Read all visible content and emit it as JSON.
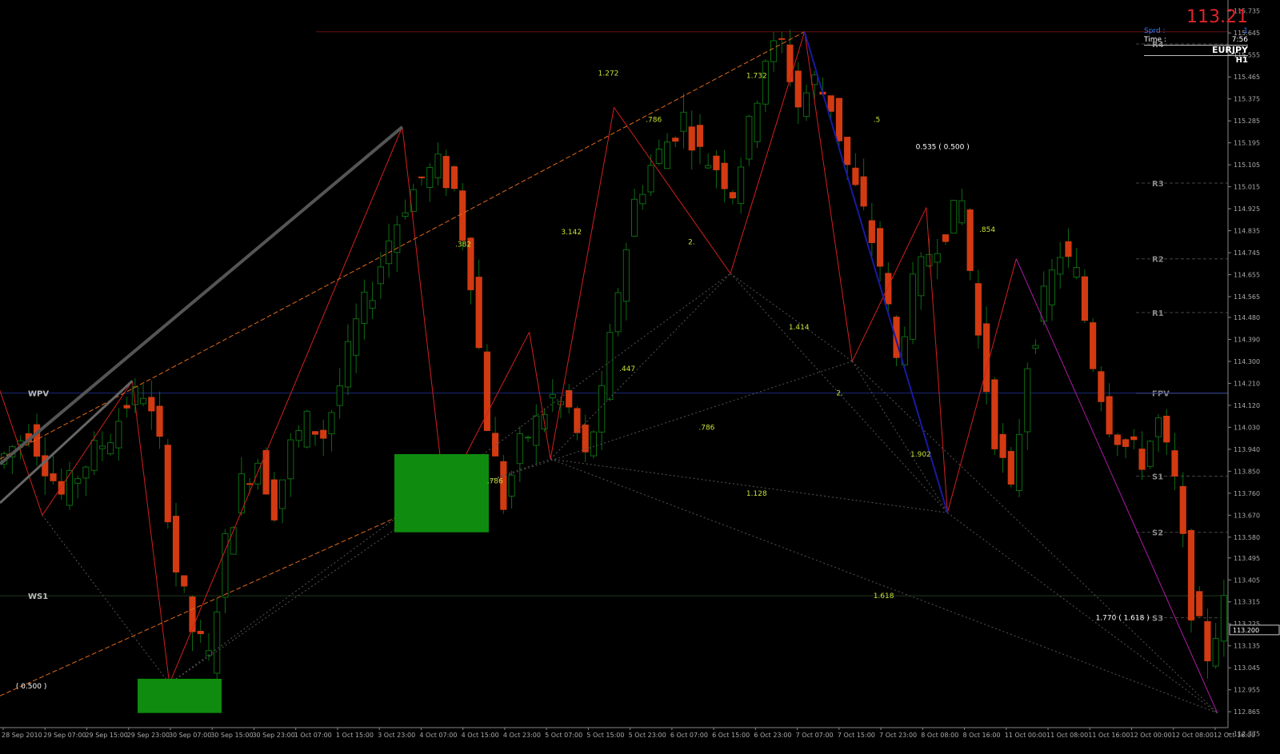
{
  "hud": {
    "price": "113.21",
    "spread_label": "Sprd :",
    "spread_value": "1",
    "time_label": "Time :",
    "time_value": "7:56",
    "symbol": "EURJPY",
    "timeframe": "H1"
  },
  "colors": {
    "background": "#000000",
    "bull": "#0d6b12",
    "bear": "#d23a12",
    "fib_text": "#c8e034",
    "pattern_line": "#d41f1f",
    "pivot_line": "#1a2a7a",
    "zone": "#0f8c0f"
  },
  "chart_data": {
    "type": "candlestick",
    "symbol": "EURJPY",
    "timeframe": "H1",
    "ylim": [
      112.8,
      115.78
    ],
    "y_ticks": [
      "115.735",
      "115.645",
      "115.555",
      "115.465",
      "115.375",
      "115.285",
      "115.195",
      "115.105",
      "115.015",
      "114.925",
      "114.835",
      "114.745",
      "114.655",
      "114.565",
      "114.480",
      "114.390",
      "114.300",
      "114.210",
      "114.120",
      "114.030",
      "113.940",
      "113.850",
      "113.760",
      "113.670",
      "113.580",
      "113.495",
      "113.405",
      "113.315",
      "113.225",
      "113.135",
      "113.045",
      "112.955",
      "112.865",
      "112.775"
    ],
    "x_ticks": [
      "28 Sep 2010",
      "29 Sep 07:00",
      "29 Sep 15:00",
      "29 Sep 23:00",
      "30 Sep 07:00",
      "30 Sep 15:00",
      "30 Sep 23:00",
      "1 Oct 07:00",
      "1 Oct 15:00",
      "3 Oct 23:00",
      "4 Oct 07:00",
      "4 Oct 15:00",
      "4 Oct 23:00",
      "5 Oct 07:00",
      "5 Oct 15:00",
      "5 Oct 23:00",
      "6 Oct 07:00",
      "6 Oct 15:00",
      "6 Oct 23:00",
      "7 Oct 07:00",
      "7 Oct 15:00",
      "7 Oct 23:00",
      "8 Oct 08:00",
      "8 Oct 16:00",
      "11 Oct 00:00",
      "11 Oct 08:00",
      "11 Oct 16:00",
      "12 Oct 00:00",
      "12 Oct 08:00",
      "12 Oct 16:00"
    ],
    "current_price_tag": "113.200",
    "close_path": [
      [
        0,
        113.88
      ],
      [
        4,
        114.02
      ],
      [
        8,
        113.75
      ],
      [
        12,
        113.93
      ],
      [
        14,
        114.0
      ],
      [
        16,
        114.13
      ],
      [
        18,
        114.18
      ],
      [
        20,
        113.95
      ],
      [
        22,
        113.45
      ],
      [
        24,
        113.2
      ],
      [
        26,
        113.08
      ],
      [
        28,
        113.55
      ],
      [
        30,
        113.8
      ],
      [
        32,
        113.9
      ],
      [
        34,
        113.7
      ],
      [
        36,
        113.95
      ],
      [
        38,
        114.05
      ],
      [
        40,
        114.0
      ],
      [
        42,
        114.2
      ],
      [
        44,
        114.45
      ],
      [
        46,
        114.6
      ],
      [
        48,
        114.8
      ],
      [
        50,
        114.95
      ],
      [
        52,
        115.05
      ],
      [
        54,
        115.1
      ],
      [
        56,
        115.0
      ],
      [
        58,
        114.65
      ],
      [
        60,
        114.05
      ],
      [
        62,
        113.72
      ],
      [
        64,
        113.95
      ],
      [
        66,
        114.05
      ],
      [
        68,
        114.15
      ],
      [
        70,
        114.1
      ],
      [
        72,
        113.9
      ],
      [
        74,
        114.15
      ],
      [
        76,
        114.6
      ],
      [
        78,
        114.95
      ],
      [
        80,
        115.1
      ],
      [
        82,
        115.2
      ],
      [
        84,
        115.3
      ],
      [
        86,
        115.15
      ],
      [
        88,
        115.1
      ],
      [
        90,
        115.0
      ],
      [
        92,
        115.25
      ],
      [
        94,
        115.55
      ],
      [
        96,
        115.6
      ],
      [
        98,
        115.35
      ],
      [
        100,
        115.45
      ],
      [
        102,
        115.35
      ],
      [
        104,
        115.1
      ],
      [
        106,
        114.9
      ],
      [
        108,
        114.7
      ],
      [
        110,
        114.3
      ],
      [
        112,
        114.6
      ],
      [
        114,
        114.75
      ],
      [
        116,
        114.85
      ],
      [
        118,
        114.95
      ],
      [
        120,
        114.4
      ],
      [
        122,
        114.0
      ],
      [
        124,
        113.75
      ],
      [
        126,
        114.3
      ],
      [
        128,
        114.55
      ],
      [
        130,
        114.75
      ],
      [
        132,
        114.65
      ],
      [
        134,
        114.3
      ],
      [
        136,
        114.05
      ],
      [
        138,
        113.95
      ],
      [
        140,
        113.9
      ],
      [
        142,
        114.05
      ],
      [
        144,
        113.8
      ],
      [
        146,
        113.3
      ],
      [
        148,
        113.1
      ],
      [
        150,
        113.3
      ]
    ],
    "candle_count": 150,
    "horizontal_levels": [
      {
        "label": "R4",
        "value": 115.6
      },
      {
        "label": "R3",
        "value": 115.03
      },
      {
        "label": "R2",
        "value": 114.72
      },
      {
        "label": "R1",
        "value": 114.5
      },
      {
        "label": "FPV",
        "value": 114.17
      },
      {
        "label": "S1",
        "value": 113.83
      },
      {
        "label": "S2",
        "value": 113.6
      },
      {
        "label": "S3",
        "value": 113.25
      },
      {
        "label": "WPV",
        "value": 114.17
      },
      {
        "label": "WS1",
        "value": 113.34
      }
    ],
    "pattern_pivots": [
      {
        "i": 0,
        "v": 114.18
      },
      {
        "i": 8,
        "v": 113.67
      },
      {
        "i": 25,
        "v": 114.22
      },
      {
        "i": 32,
        "v": 112.98
      },
      {
        "i": 76,
        "v": 115.26
      },
      {
        "i": 84,
        "v": 113.75
      },
      {
        "i": 100,
        "v": 114.42
      },
      {
        "i": 104,
        "v": 113.9
      },
      {
        "i": 116,
        "v": 115.34
      },
      {
        "i": 138,
        "v": 114.66
      },
      {
        "i": 152,
        "v": 115.65
      },
      {
        "i": 161,
        "v": 114.3
      },
      {
        "i": 175,
        "v": 114.93
      },
      {
        "i": 179,
        "v": 113.68
      },
      {
        "i": 192,
        "v": 114.72
      },
      {
        "i": 230,
        "v": 112.86
      }
    ],
    "fib_labels": [
      {
        "text": "1.272",
        "i": 113,
        "v": 115.47
      },
      {
        "text": ".382",
        "i": 86,
        "v": 114.77
      },
      {
        "text": ".786",
        "i": 122,
        "v": 115.28
      },
      {
        "text": "3.142",
        "i": 106,
        "v": 114.82
      },
      {
        "text": "2.",
        "i": 130,
        "v": 114.78
      },
      {
        "text": "1.732",
        "i": 141,
        "v": 115.46
      },
      {
        "text": ".5",
        "i": 165,
        "v": 115.28
      },
      {
        "text": "0.535 ( 0.500 )",
        "i": 173,
        "v": 115.17
      },
      {
        "text": ".854",
        "i": 185,
        "v": 114.83
      },
      {
        "text": "1.414",
        "i": 149,
        "v": 114.43
      },
      {
        "text": ".447",
        "i": 117,
        "v": 114.26
      },
      {
        "text": "2.",
        "i": 158,
        "v": 114.16
      },
      {
        "text": ".786",
        "i": 132,
        "v": 114.02
      },
      {
        "text": ".786",
        "i": 92,
        "v": 113.8
      },
      {
        "text": "1.902",
        "i": 172,
        "v": 113.91
      },
      {
        "text": "1.128",
        "i": 141,
        "v": 113.75
      },
      {
        "text": "1.618",
        "i": 165,
        "v": 113.33
      },
      {
        "text": "1.770 ( 1.618 )",
        "i": 207,
        "v": 113.24
      },
      {
        "text": "( 0.500 )",
        "i": 3,
        "v": 112.96
      }
    ]
  }
}
